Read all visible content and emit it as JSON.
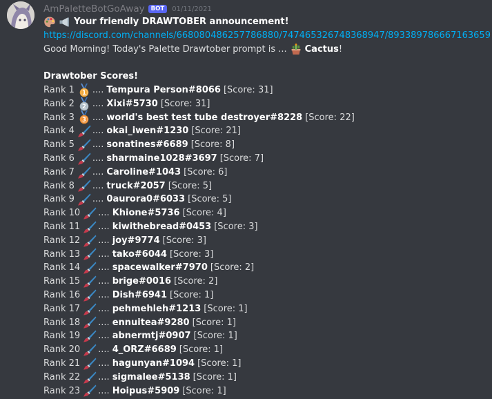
{
  "message": {
    "username": "AmPaletteBotGoAway",
    "bot_badge": "BOT",
    "timestamp": "01/11/2021",
    "announcement_title": "Your friendly DRAWTOBER announcement!",
    "link": "https://discord.com/channels/668080486257786880/747465326748368947/893389786667163659",
    "greeting_prefix": "Good Morning! Today's Palette Drawtober prompt is ...",
    "prompt_word": "Cactus",
    "greeting_suffix": "!",
    "scores_heading": "Drawtober Scores!",
    "dots": "....",
    "icon_colors": {
      "gold": "#f2a93b",
      "silver": "#aab8c2",
      "bronze": "#f08c2d",
      "ribbon": "#5b8fd3",
      "brush": "#3b88c3"
    }
  },
  "scores": [
    {
      "rank": "Rank 1",
      "icon": "medal-1-icon",
      "medal": "1",
      "name": "Tempura Person#8066",
      "score": "[Score: 31]"
    },
    {
      "rank": "Rank 2",
      "icon": "medal-2-icon",
      "medal": "2",
      "name": "Xixi#5730",
      "score": "[Score: 31]"
    },
    {
      "rank": "Rank 3",
      "icon": "medal-3-icon",
      "medal": "3",
      "name": "world's best test tube destroyer#8228",
      "score": "[Score: 22]"
    },
    {
      "rank": "Rank 4",
      "icon": "paintbrush-icon",
      "name": "okai_iwen#1230",
      "score": "[Score: 21]"
    },
    {
      "rank": "Rank 5",
      "icon": "paintbrush-icon",
      "name": "sonatines#6689",
      "score": "[Score: 8]"
    },
    {
      "rank": "Rank 6",
      "icon": "paintbrush-icon",
      "name": "sharmaine1028#3697",
      "score": "[Score: 7]"
    },
    {
      "rank": "Rank 7",
      "icon": "paintbrush-icon",
      "name": "Caroline#1043",
      "score": "[Score: 6]"
    },
    {
      "rank": "Rank 8",
      "icon": "paintbrush-icon",
      "name": "truck#2057",
      "score": "[Score: 5]"
    },
    {
      "rank": "Rank 9",
      "icon": "paintbrush-icon",
      "name": "0aurora0#6033",
      "score": "[Score: 5]"
    },
    {
      "rank": "Rank 10",
      "icon": "paintbrush-icon",
      "name": "Khione#5736",
      "score": "[Score: 4]"
    },
    {
      "rank": "Rank 11",
      "icon": "paintbrush-icon",
      "name": "kiwithebread#0453",
      "score": "[Score: 3]"
    },
    {
      "rank": "Rank 12",
      "icon": "paintbrush-icon",
      "name": "joy#9774",
      "score": "[Score: 3]"
    },
    {
      "rank": "Rank 13",
      "icon": "paintbrush-icon",
      "name": "tako#6044",
      "score": "[Score: 3]"
    },
    {
      "rank": "Rank 14",
      "icon": "paintbrush-icon",
      "name": "spacewalker#7970",
      "score": "[Score: 2]"
    },
    {
      "rank": "Rank 15",
      "icon": "paintbrush-icon",
      "name": "brige#0016",
      "score": "[Score: 2]"
    },
    {
      "rank": "Rank 16",
      "icon": "paintbrush-icon",
      "name": "Dish#6941",
      "score": "[Score: 1]"
    },
    {
      "rank": "Rank 17",
      "icon": "paintbrush-icon",
      "name": "pehmehleh#1213",
      "score": "[Score: 1]"
    },
    {
      "rank": "Rank 18",
      "icon": "paintbrush-icon",
      "name": "ennuitea#9280",
      "score": "[Score: 1]"
    },
    {
      "rank": "Rank 19",
      "icon": "paintbrush-icon",
      "name": "abnermtj#0907",
      "score": "[Score: 1]"
    },
    {
      "rank": "Rank 20",
      "icon": "paintbrush-icon",
      "name": "4_ORZ#6689",
      "score": "[Score: 1]"
    },
    {
      "rank": "Rank 21",
      "icon": "paintbrush-icon",
      "name": "hagunyan#1094",
      "score": "[Score: 1]"
    },
    {
      "rank": "Rank 22",
      "icon": "paintbrush-icon",
      "name": "sigmalee#5138",
      "score": "[Score: 1]"
    },
    {
      "rank": "Rank 23",
      "icon": "paintbrush-icon",
      "name": "Hoipus#5909",
      "score": "[Score: 1]"
    }
  ]
}
